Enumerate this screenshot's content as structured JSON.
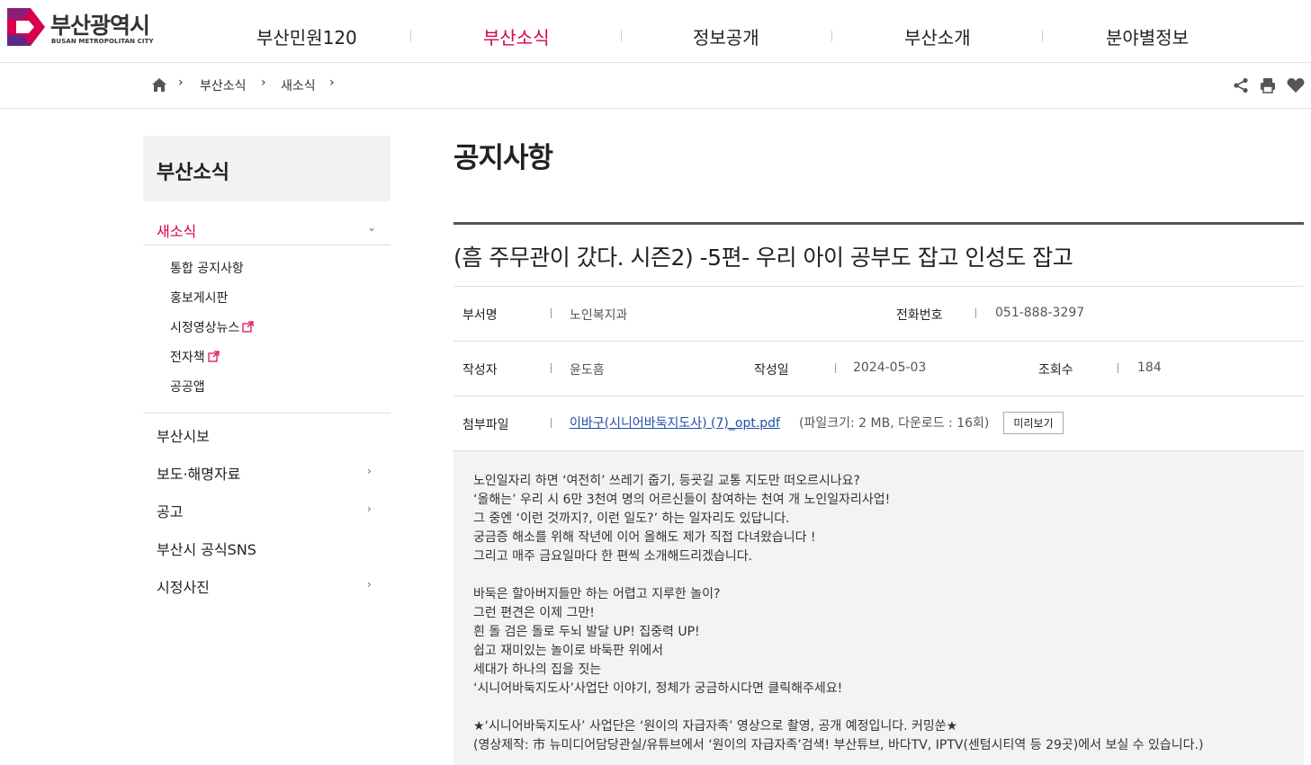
{
  "site": {
    "name_ko": "부산광역시",
    "name_en": "BUSAN METROPOLITAN CITY",
    "brand_color": "#d6004f"
  },
  "gnb": [
    {
      "label": "부산민원120",
      "active": false
    },
    {
      "label": "부산소식",
      "active": true
    },
    {
      "label": "정보공개",
      "active": false
    },
    {
      "label": "부산소개",
      "active": false
    },
    {
      "label": "분야별정보",
      "active": false
    }
  ],
  "breadcrumb": {
    "home_icon": "home-icon",
    "items": [
      "부산소식",
      "새소식"
    ]
  },
  "tools": [
    "share-icon",
    "print-icon",
    "heart-icon"
  ],
  "sidebar": {
    "title": "부산소식",
    "current": "새소식",
    "sub_items": [
      {
        "label": "통합 공지사항",
        "external": false
      },
      {
        "label": "홍보게시판",
        "external": false
      },
      {
        "label": "시정영상뉴스",
        "external": true
      },
      {
        "label": "전자책",
        "external": true
      },
      {
        "label": "공공앱",
        "external": false
      }
    ],
    "items": [
      {
        "label": "부산시보",
        "has_children": false
      },
      {
        "label": "보도·해명자료",
        "has_children": true
      },
      {
        "label": "공고",
        "has_children": true
      },
      {
        "label": "부산시 공식SNS",
        "has_children": false
      },
      {
        "label": "시정사진",
        "has_children": true
      }
    ]
  },
  "page_title": "공지사항",
  "post": {
    "title": "(흠 주무관이 갔다. 시즌2) -5편- 우리 아이 공부도 잡고 인성도 잡고",
    "dept_label": "부서명",
    "dept": "노인복지과",
    "phone_label": "전화번호",
    "phone": "051-888-3297",
    "author_label": "작성자",
    "author": "윤도흠",
    "date_label": "작성일",
    "date": "2024-05-03",
    "views_label": "조회수",
    "views": "184",
    "attach_label": "첨부파일",
    "attach_file": "이바구(시니어바둑지도사) (7)_opt.pdf",
    "attach_info": "(파일크기: 2 MB, 다운로드 : 16회)",
    "preview_label": "미리보기",
    "body": [
      "노인일자리 하면 ‘여전히’ 쓰레기 줍기, 등굣길 교통 지도만 떠오르시나요?",
      "‘올해는’ 우리 시 6만 3천여 명의 어르신들이 참여하는 천여 개 노인일자리사업!",
      "그 중엔 ‘이런 것까지?, 이런 일도?’ 하는 일자리도 있답니다.",
      "궁금증 해소를 위해 작년에 이어 올해도 제가 직접 다녀왔습니다 !",
      "그리고 매주 금요일마다 한 편씩 소개해드리겠습니다.",
      "",
      "바둑은 할아버지들만 하는 어렵고 지루한 놀이?",
      "그런 편견은 이제 그만!",
      "흰 돌 검은 돌로 두뇌 발달 UP! 집중력 UP!",
      "쉽고 재미있는 놀이로 바둑판 위에서",
      "세대가 하나의 집을 짓는",
      "‘시니어바둑지도사’사업단 이야기, 정체가 궁금하시다면 클릭해주세요!",
      "",
      "★‘시니어바둑지도사’ 사업단은 ‘원이의 자급자족’ 영상으로 촬영, 공개 예정입니다. 커밍쑨★",
      "(영상제작: 市 뉴미디어담당관실/유튜브에서 ‘원이의 자급자족’검색! 부산튜브, 바다TV, IPTV(센텀시티역 등 29곳)에서 보실 수 있습니다.)"
    ]
  }
}
